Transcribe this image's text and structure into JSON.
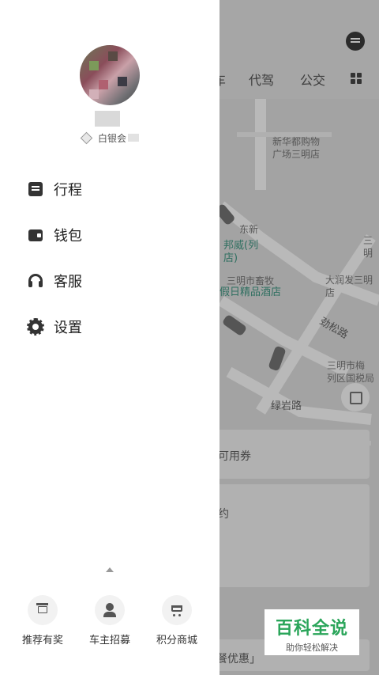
{
  "map": {
    "tabs": [
      "车",
      "代驾",
      "公交"
    ],
    "poi": {
      "xinhuadu": "新华都购物\n广场三明店",
      "dongxin": "东新",
      "bangwei": "邦威(列\n店)",
      "xumu": "三明市畜牧",
      "jiajiu": "假日精品酒店",
      "dadun": "大润发三明店",
      "sanming": "三明",
      "shuiwu": "三明市梅\n列区国税局"
    },
    "roads": {
      "jinsong": "劲松路",
      "lvyan": "绿岩路"
    },
    "cards": {
      "coupon": "可用券",
      "yue": "约",
      "promo": "餐优惠」"
    }
  },
  "drawer": {
    "member_level": "白银会"
  },
  "menu": [
    {
      "label": "行程",
      "icon": "trip-icon"
    },
    {
      "label": "钱包",
      "icon": "wallet-icon"
    },
    {
      "label": "客服",
      "icon": "headset-icon"
    },
    {
      "label": "设置",
      "icon": "settings-icon"
    }
  ],
  "bottom": [
    {
      "label": "推荐有奖",
      "icon": "gift-icon"
    },
    {
      "label": "车主招募",
      "icon": "driver-icon"
    },
    {
      "label": "积分商城",
      "icon": "cart-icon"
    }
  ],
  "watermark": {
    "title": "百科全说",
    "subtitle": "助你轻松解决"
  }
}
